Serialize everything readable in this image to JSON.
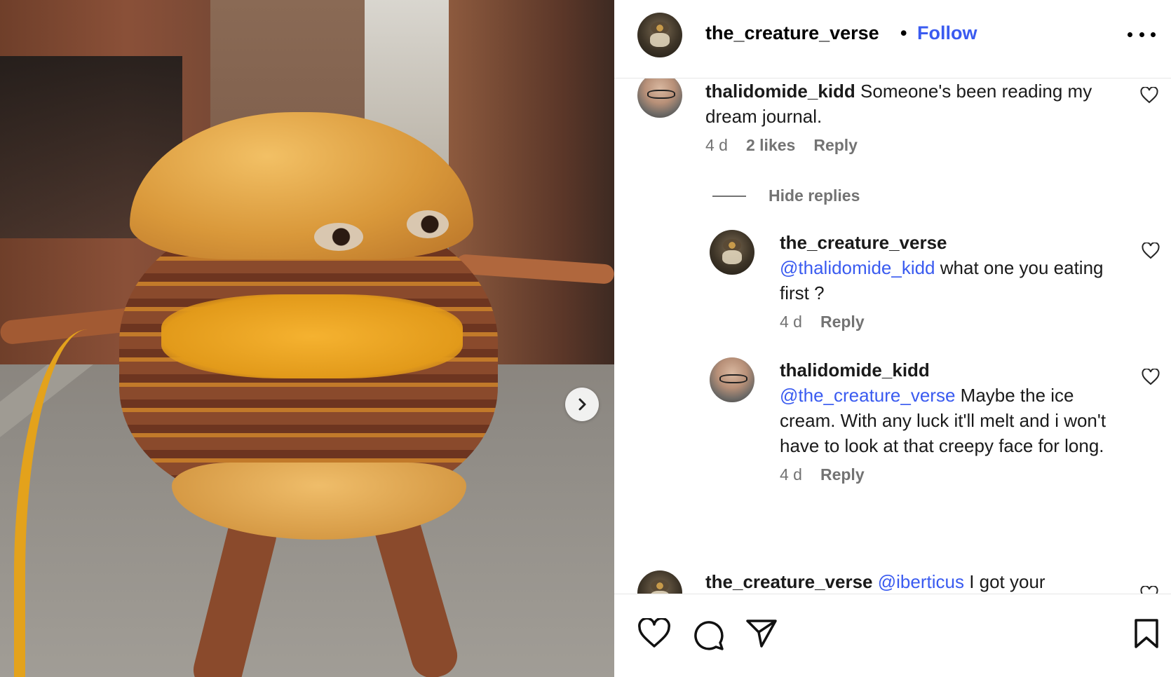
{
  "post": {
    "author": "the_creature_verse",
    "separator": "•",
    "follow_label": "Follow"
  },
  "comments": [
    {
      "user": "thalidomide_kidd",
      "text": "Someone's been reading my dream journal.",
      "age": "4 d",
      "likes": "2 likes",
      "reply_label": "Reply"
    }
  ],
  "hide_replies_label": "Hide replies",
  "replies": [
    {
      "user": "the_creature_verse",
      "mention": "@thalidomide_kidd",
      "text": "what one you eating first ?",
      "age": "4 d",
      "reply_label": "Reply"
    },
    {
      "user": "thalidomide_kidd",
      "mention": "@the_creature_verse",
      "text": "Maybe the ice cream. With any luck it'll melt and i won't have to look at that creepy face for long.",
      "age": "4 d",
      "reply_label": "Reply"
    }
  ],
  "partial_comment": {
    "user": "the_creature_verse",
    "mention": "@iberticus",
    "text": "I got your"
  },
  "icons": {
    "next": "chevron-right-icon",
    "more": "more-options-icon",
    "like": "heart-icon",
    "comment": "comment-icon",
    "share": "send-icon",
    "save": "bookmark-icon"
  },
  "colors": {
    "link": "#3a5bf0",
    "meta": "#737373"
  }
}
